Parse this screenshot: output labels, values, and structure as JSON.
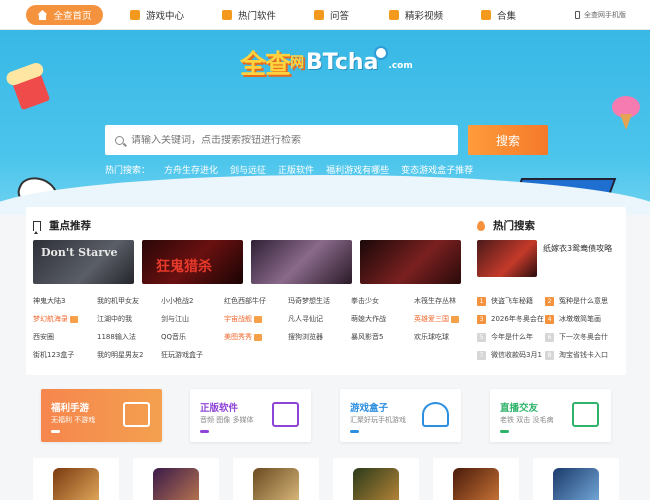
{
  "nav": {
    "items": [
      {
        "label": "全查首页",
        "icon": "home-icon"
      },
      {
        "label": "游戏中心",
        "icon": "gamepad-icon"
      },
      {
        "label": "热门软件",
        "icon": "software-icon"
      },
      {
        "label": "问答",
        "icon": "chat-icon"
      },
      {
        "label": "精彩视频",
        "icon": "video-icon"
      },
      {
        "label": "合集",
        "icon": "folder-icon"
      }
    ],
    "mobile_label": "全查网手机版"
  },
  "hero": {
    "logo_cn": "全查",
    "logo_net": "网",
    "logo_en": "BTcha",
    "logo_tld": ".com",
    "search_placeholder": "请输入关键词，点击搜索按钮进行检索",
    "search_button": "搜索",
    "hot_label": "热门搜索：",
    "hot_terms": [
      "方舟生存进化",
      "剑与远征",
      "正版软件",
      "福利游戏有哪些",
      "变态游戏盒子推荐"
    ]
  },
  "featured": {
    "title": "重点推荐",
    "images": [
      {
        "caption": "Don't Starve",
        "bg": "#3a3d44"
      },
      {
        "caption": "狂鬼猎杀",
        "bg": "#4a0e0e"
      },
      {
        "caption": "",
        "bg": "#5b3d4e"
      },
      {
        "caption": "",
        "bg": "#3b1414"
      }
    ],
    "links": [
      [
        "神鬼大陆3",
        "我的机甲女友",
        "小小枪战2",
        "红色西部牛仔",
        "玛奇梦想生活",
        "拳击少女",
        "木筏生存丛林"
      ],
      [
        "梦幻航海录",
        "江湖中的我",
        "剑与江山",
        "宇宙战舰",
        "凡人寻仙记",
        "萌媳大作战",
        "英雄爱三国"
      ],
      [
        "西安圈",
        "1188输入法",
        "QQ音乐",
        "美图秀秀",
        "搜狗浏览器",
        "暴风影音5",
        "欢乐球吃球"
      ],
      [
        "街机123盒子",
        "我的明星男友2",
        "狂玩游戏盒子"
      ]
    ]
  },
  "hot": {
    "title": "热门搜索",
    "top_title": "纸嫁衣3鸳鸯债攻略",
    "ranks": [
      {
        "num": "1",
        "label": "侠盗飞车秘籍"
      },
      {
        "num": "2",
        "label": "冤种是什么意思"
      },
      {
        "num": "3",
        "label": "2026年冬奥会在"
      },
      {
        "num": "4",
        "label": "冰墩墩简笔画"
      },
      {
        "num": "5",
        "label": "今年是什么年"
      },
      {
        "num": "6",
        "label": "下一次冬奥会什"
      },
      {
        "num": "7",
        "label": "微信收款码3月1"
      },
      {
        "num": "8",
        "label": "淘宝省钱卡入口"
      }
    ]
  },
  "categories": [
    {
      "title": "福利手游",
      "sub": "无福利 不游戏",
      "color": "#ffffff"
    },
    {
      "title": "正版软件",
      "sub": "音频 图像 多媒体",
      "color": "#8e44d6"
    },
    {
      "title": "游戏盒子",
      "sub": "汇聚好玩手机游戏",
      "color": "#2d8fe0"
    },
    {
      "title": "直播交友",
      "sub": "老铁 双击 没毛病",
      "color": "#2fb36a"
    }
  ],
  "colors": {
    "accent": "#f5923e",
    "hero_blue": "#38b8e6",
    "link_orange": "#f06a30"
  }
}
